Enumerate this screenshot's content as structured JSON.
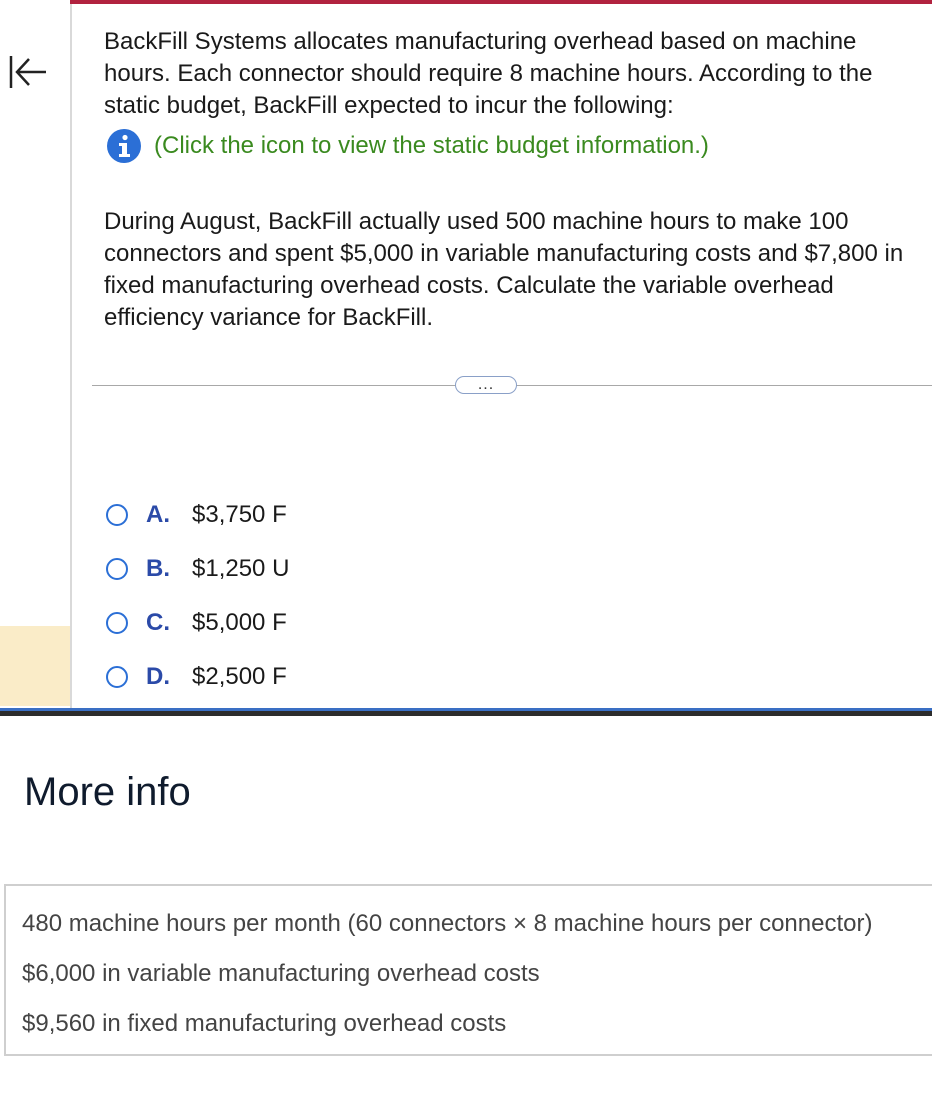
{
  "question": {
    "paragraph1": "BackFill Systems allocates manufacturing overhead based on machine hours. Each connector should require 8 machine hours. According to the static budget, BackFill expected to incur the following:",
    "info_link": "(Click the icon to view the static budget information.)",
    "paragraph2": "During August, BackFill actually used 500 machine hours to make 100 connectors and spent $5,000 in variable manufacturing costs and $7,800 in fixed manufacturing overhead costs. Calculate the variable overhead efficiency variance for BackFill."
  },
  "divider": {
    "expand_label": "..."
  },
  "options": [
    {
      "letter": "A.",
      "value": "$3,750 F"
    },
    {
      "letter": "B.",
      "value": "$1,250 U"
    },
    {
      "letter": "C.",
      "value": "$5,000 F"
    },
    {
      "letter": "D.",
      "value": "$2,500 F"
    }
  ],
  "more_info": {
    "title": "More info",
    "rows": [
      "480 machine hours per month (60 connectors × 8 machine hours per connector)",
      "$6,000 in variable manufacturing overhead costs",
      "$9,560 in fixed manufacturing overhead costs"
    ]
  },
  "colors": {
    "accent": "#b1223f",
    "link_green": "#3a8a1f",
    "option_letter": "#2b4aa8",
    "radio": "#2b6fd6",
    "rail_highlight": "#faecc8"
  },
  "icons": {
    "collapse": "collapse-left-icon",
    "info": "info-icon"
  }
}
